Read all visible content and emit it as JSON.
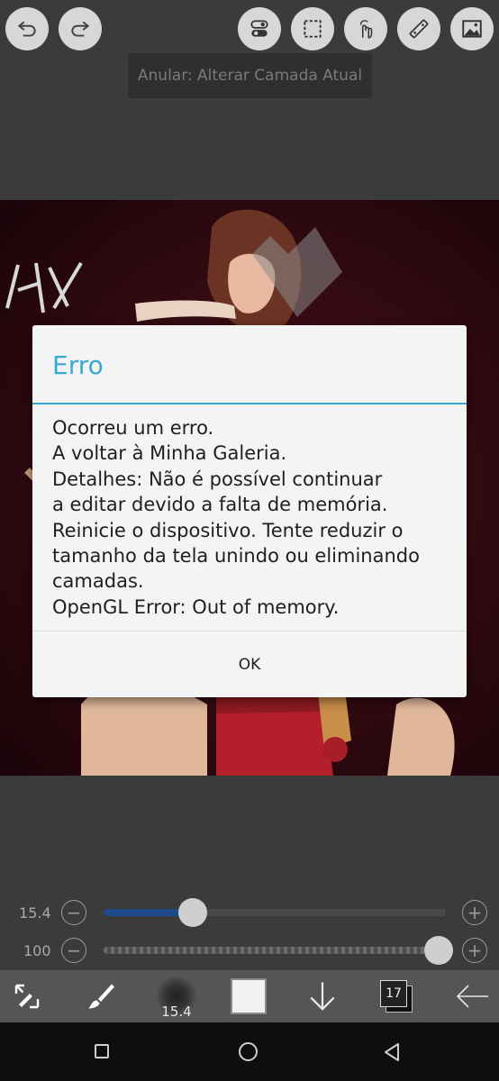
{
  "top_toolbar": {
    "undo_icon": "undo-arrow",
    "redo_icon": "redo-arrow",
    "tools": [
      "toggle-icon",
      "selection-icon",
      "touch-icon",
      "ruler-icon",
      "image-icon"
    ]
  },
  "toast": {
    "text": "Anular: Alterar Camada Atual"
  },
  "dialog": {
    "title": "Erro",
    "message_lines": [
      "Ocorreu um erro.",
      "A voltar à Minha Galeria.",
      "Detalhes: Não é possível continuar",
      "a editar devido a falta de memória.",
      "Reinicie o dispositivo. Tente reduzir o",
      "tamanho da tela unindo ou eliminando",
      "camadas.",
      "OpenGL Error: Out of memory."
    ],
    "ok_label": "OK"
  },
  "sliders": {
    "size": {
      "label": "15.4",
      "level_fraction": 0.24
    },
    "opacity": {
      "label": "100",
      "level_fraction": 1.0
    }
  },
  "bottom_toolbar": {
    "brush_size_label": "15.4",
    "layer_count": "17"
  },
  "colors": {
    "accent": "#3aa9cf",
    "dialog_bg": "#f4f4f4",
    "slider_fill": "#1d4a8a"
  }
}
